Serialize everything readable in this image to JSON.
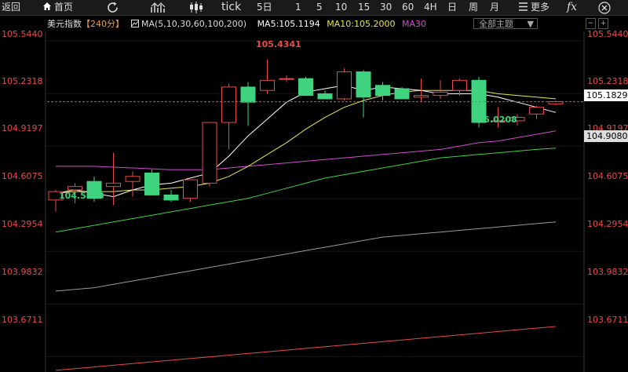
{
  "toolbar": {
    "back_label": "返回",
    "home_label": "首页",
    "tick_label": "tick",
    "periods": [
      "5日",
      "1",
      "5",
      "10",
      "15",
      "30",
      "60",
      "4H",
      "日",
      "周",
      "月"
    ],
    "more_label": "更多",
    "fx_label": "fx"
  },
  "info": {
    "instrument": "美元指数",
    "period_tag": "【240分】",
    "ma_list": "MA(5,10,30,60,100,200)",
    "ma5": "MA5:105.1194",
    "ma10": "MA10:105.2000",
    "ma30": "MA30"
  },
  "theme_select": {
    "label": "全部主题",
    "arrow": "▼"
  },
  "side_buttons": [
    "−",
    "+"
  ],
  "y_axis": {
    "labels": [
      "105.5440",
      "105.2318",
      "104.9197",
      "104.6075",
      "104.2954",
      "103.9832",
      "103.6711"
    ],
    "left_labels": [
      "105.5440",
      "105.2318",
      "104.9197",
      "104.6075",
      "104.2954",
      "103.9832",
      "103.6711"
    ]
  },
  "current_price_tag": "105.1829",
  "ma_value_tag": "104.9080",
  "annotations": {
    "high": "105.4341",
    "low_left": "104.5183",
    "low_right": "105.0208"
  },
  "colors": {
    "up": "#e84b4b",
    "down": "#3fd37f",
    "ma5": "#ffffff",
    "ma10": "#e8e84a",
    "ma30": "#d24bd2",
    "ma60": "#3fd33f",
    "ma100": "#9a9a9a",
    "ma200": "#e84b4b"
  },
  "chart_data": {
    "type": "candlestick",
    "ylim": [
      103.58,
      105.6
    ],
    "candles": [
      {
        "o": 104.6,
        "h": 104.66,
        "l": 104.53,
        "c": 104.65
      },
      {
        "o": 104.66,
        "h": 104.7,
        "l": 104.58,
        "c": 104.68
      },
      {
        "o": 104.71,
        "h": 104.74,
        "l": 104.59,
        "c": 104.61
      },
      {
        "o": 104.68,
        "h": 104.88,
        "l": 104.57,
        "c": 104.7
      },
      {
        "o": 104.71,
        "h": 104.77,
        "l": 104.62,
        "c": 104.74
      },
      {
        "o": 104.76,
        "h": 104.78,
        "l": 104.64,
        "c": 104.63
      },
      {
        "o": 104.63,
        "h": 104.66,
        "l": 104.59,
        "c": 104.6
      },
      {
        "o": 104.61,
        "h": 104.72,
        "l": 104.59,
        "c": 104.72
      },
      {
        "o": 104.7,
        "h": 105.06,
        "l": 104.68,
        "c": 105.06
      },
      {
        "o": 105.06,
        "h": 105.29,
        "l": 104.9,
        "c": 105.27
      },
      {
        "o": 105.27,
        "h": 105.3,
        "l": 105.04,
        "c": 105.18
      },
      {
        "o": 105.25,
        "h": 105.434,
        "l": 105.23,
        "c": 105.31
      },
      {
        "o": 105.32,
        "h": 105.34,
        "l": 105.3,
        "c": 105.32
      },
      {
        "o": 105.32,
        "h": 105.33,
        "l": 105.22,
        "c": 105.22
      },
      {
        "o": 105.23,
        "h": 105.25,
        "l": 105.2,
        "c": 105.2
      },
      {
        "o": 105.2,
        "h": 105.38,
        "l": 105.19,
        "c": 105.36
      },
      {
        "o": 105.36,
        "h": 105.37,
        "l": 105.09,
        "c": 105.21
      },
      {
        "o": 105.28,
        "h": 105.3,
        "l": 105.19,
        "c": 105.22
      },
      {
        "o": 105.26,
        "h": 105.27,
        "l": 105.2,
        "c": 105.2
      },
      {
        "o": 105.21,
        "h": 105.32,
        "l": 105.18,
        "c": 105.22
      },
      {
        "o": 105.22,
        "h": 105.31,
        "l": 105.2,
        "c": 105.24
      },
      {
        "o": 105.25,
        "h": 105.32,
        "l": 105.22,
        "c": 105.31
      },
      {
        "o": 105.31,
        "h": 105.33,
        "l": 105.03,
        "c": 105.06
      },
      {
        "o": 105.07,
        "h": 105.15,
        "l": 105.03,
        "c": 105.07
      },
      {
        "o": 105.07,
        "h": 105.11,
        "l": 105.04,
        "c": 105.09
      },
      {
        "o": 105.11,
        "h": 105.16,
        "l": 105.08,
        "c": 105.15
      },
      {
        "o": 105.17,
        "h": 105.19,
        "l": 105.16,
        "c": 105.183
      }
    ],
    "ma5": [
      104.64,
      104.66,
      104.64,
      104.62,
      104.66,
      104.69,
      104.7,
      104.73,
      104.76,
      104.86,
      104.98,
      105.08,
      105.18,
      105.24,
      105.26,
      105.28,
      105.25,
      105.27,
      105.26,
      105.25,
      105.23,
      105.23,
      105.23,
      105.21,
      105.18,
      105.15,
      105.119
    ],
    "ma10": [
      104.64,
      104.65,
      104.65,
      104.65,
      104.66,
      104.66,
      104.67,
      104.68,
      104.7,
      104.74,
      104.8,
      104.87,
      104.94,
      105.02,
      105.09,
      105.15,
      105.19,
      105.22,
      105.24,
      105.25,
      105.25,
      105.25,
      105.25,
      105.23,
      105.22,
      105.21,
      105.2
    ],
    "ma30": [
      104.8,
      104.8,
      104.8,
      104.795,
      104.79,
      104.785,
      104.78,
      104.78,
      104.78,
      104.79,
      104.8,
      104.81,
      104.82,
      104.83,
      104.84,
      104.85,
      104.86,
      104.87,
      104.88,
      104.89,
      104.9,
      104.92,
      104.94,
      104.95,
      104.97,
      104.99,
      105.01
    ],
    "ma60": [
      104.41,
      104.43,
      104.45,
      104.47,
      104.49,
      104.51,
      104.53,
      104.55,
      104.57,
      104.59,
      104.61,
      104.64,
      104.67,
      104.7,
      104.73,
      104.75,
      104.77,
      104.79,
      104.81,
      104.83,
      104.85,
      104.86,
      104.87,
      104.88,
      104.89,
      104.9,
      104.908
    ],
    "ma100": [
      104.06,
      104.07,
      104.08,
      104.1,
      104.12,
      104.14,
      104.16,
      104.18,
      104.2,
      104.22,
      104.24,
      104.26,
      104.28,
      104.3,
      104.32,
      104.34,
      104.36,
      104.38,
      104.39,
      104.4,
      104.41,
      104.42,
      104.43,
      104.44,
      104.45,
      104.46,
      104.47
    ],
    "ma200": [
      103.59,
      103.6,
      103.61,
      103.62,
      103.63,
      103.64,
      103.65,
      103.66,
      103.67,
      103.68,
      103.69,
      103.7,
      103.71,
      103.72,
      103.73,
      103.74,
      103.75,
      103.76,
      103.77,
      103.78,
      103.79,
      103.8,
      103.81,
      103.82,
      103.83,
      103.84,
      103.85
    ],
    "current_price": 105.1829
  }
}
